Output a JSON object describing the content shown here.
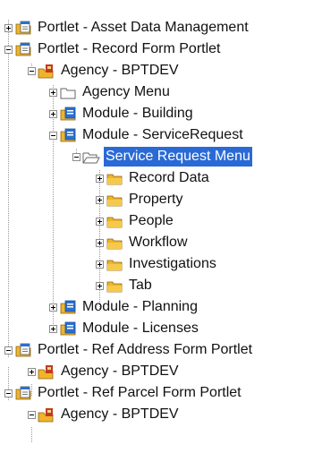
{
  "tree": {
    "nodes": [
      {
        "label": "Portlet - Asset Data Management",
        "icon": "portlet-icon",
        "toggle": "plus"
      },
      {
        "label": "Portlet - Record Form Portlet",
        "icon": "portlet-icon",
        "toggle": "minus"
      },
      {
        "label": "Agency - BPTDEV",
        "icon": "agency-icon",
        "toggle": "minus"
      },
      {
        "label": "Agency Menu",
        "icon": "empty-folder-icon",
        "toggle": "plus"
      },
      {
        "label": "Module - Building",
        "icon": "module-icon",
        "toggle": "plus"
      },
      {
        "label": "Module - ServiceRequest",
        "icon": "module-icon",
        "toggle": "minus"
      },
      {
        "label": "Service Request Menu",
        "icon": "open-folder-icon",
        "toggle": "minus",
        "selected": true
      },
      {
        "label": "Record Data",
        "icon": "folder-icon",
        "toggle": "plus"
      },
      {
        "label": "Property",
        "icon": "folder-icon",
        "toggle": "plus"
      },
      {
        "label": "People",
        "icon": "folder-icon",
        "toggle": "plus"
      },
      {
        "label": "Workflow",
        "icon": "folder-icon",
        "toggle": "plus"
      },
      {
        "label": "Investigations",
        "icon": "folder-icon",
        "toggle": "plus"
      },
      {
        "label": "Tab",
        "icon": "folder-icon",
        "toggle": "plus"
      },
      {
        "label": "Module - Planning",
        "icon": "module-icon",
        "toggle": "plus"
      },
      {
        "label": "Module - Licenses",
        "icon": "module-icon",
        "toggle": "plus"
      },
      {
        "label": "Portlet - Ref Address Form Portlet",
        "icon": "portlet-icon",
        "toggle": "minus"
      },
      {
        "label": "Agency - BPTDEV",
        "icon": "agency-icon",
        "toggle": "plus"
      },
      {
        "label": "Portlet - Ref Parcel Form Portlet",
        "icon": "portlet-icon",
        "toggle": "minus"
      },
      {
        "label": "Agency - BPTDEV",
        "icon": "agency-icon",
        "toggle": "minus"
      }
    ]
  },
  "colors": {
    "selection": "#2a6ad6",
    "folder": "#f0b428",
    "module_blue": "#2b6fd0",
    "guide_line": "#9a9a9a"
  }
}
